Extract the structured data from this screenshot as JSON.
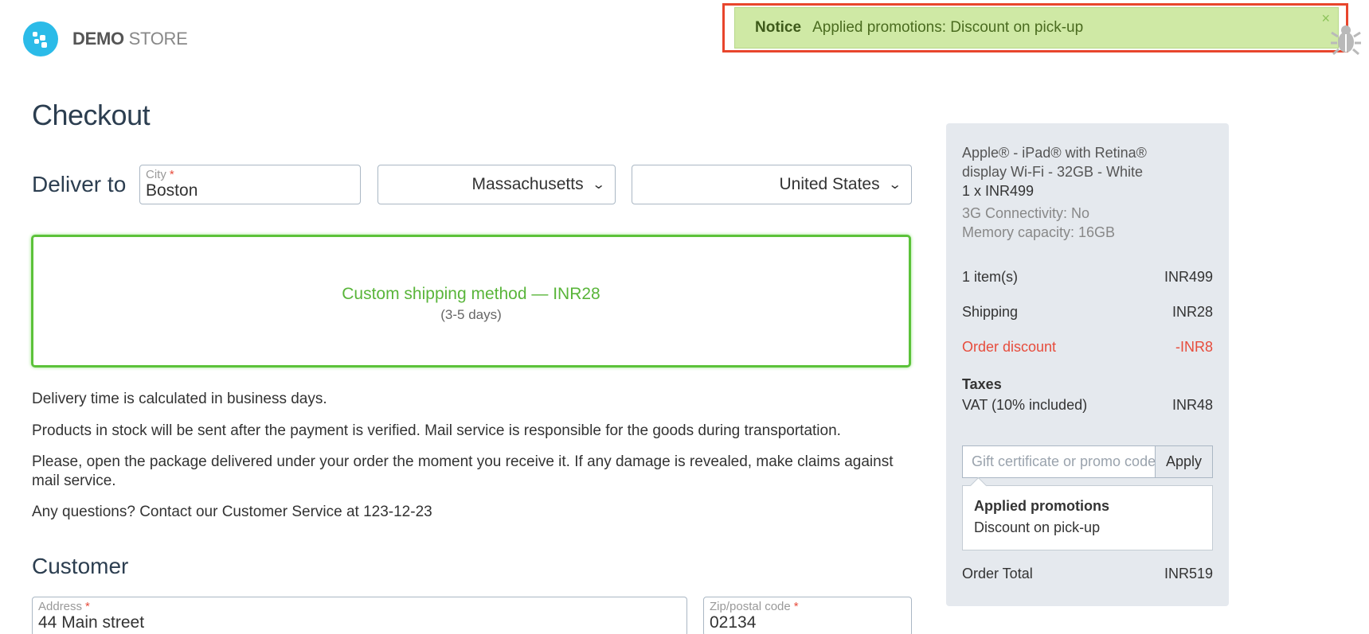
{
  "header": {
    "logo_demo": "DEMO",
    "logo_store": "STORE"
  },
  "notice": {
    "title": "Notice",
    "message": "Applied promotions: Discount on pick-up",
    "close": "×"
  },
  "page_title": "Checkout",
  "delivery": {
    "label": "Deliver to",
    "city_label": "City",
    "required_mark": "*",
    "city_value": "Boston",
    "state_value": "Massachusetts",
    "country_value": "United States"
  },
  "shipping": {
    "method": "Custom shipping method — INR28",
    "days": "(3-5 days)"
  },
  "info": [
    "Delivery time is calculated in business days.",
    "Products in stock will be sent after the payment is verified. Mail service is responsible for the goods during transportation.",
    "Please, open the package delivered under your order the moment you receive it. If any damage is revealed, make claims against mail service.",
    "Any questions? Contact our Customer Service at 123-12-23"
  ],
  "customer": {
    "title": "Customer",
    "address_label": "Address",
    "address_value": "44 Main street",
    "zip_label": "Zip/postal code",
    "zip_value": "02134"
  },
  "summary": {
    "product_name": "Apple® - iPad® with Retina® display Wi-Fi - 32GB - White",
    "product_qty": "1 x INR499",
    "options": [
      "3G Connectivity: No",
      "Memory capacity: 16GB"
    ],
    "items_label": "1 item(s)",
    "items_value": "INR499",
    "shipping_label": "Shipping",
    "shipping_value": "INR28",
    "discount_label": "Order discount",
    "discount_value": "-INR8",
    "taxes_label": "Taxes",
    "vat_label": "VAT (10% included)",
    "vat_value": "INR48",
    "promo_placeholder": "Gift certificate or promo code",
    "apply_label": "Apply",
    "applied_title": "Applied promotions",
    "applied_item": "Discount on pick-up",
    "total_label": "Order Total",
    "total_value": "INR519"
  },
  "colors": {
    "accent": "#2bbbe8",
    "notice_bg": "#cfe9a5",
    "highlight_outline": "#e8452c",
    "shipping_green": "#5cc23a",
    "discount_red": "#e74c3c"
  },
  "icons": [
    "logo-icon",
    "close-icon",
    "bug-icon",
    "chevron-down-icon"
  ]
}
